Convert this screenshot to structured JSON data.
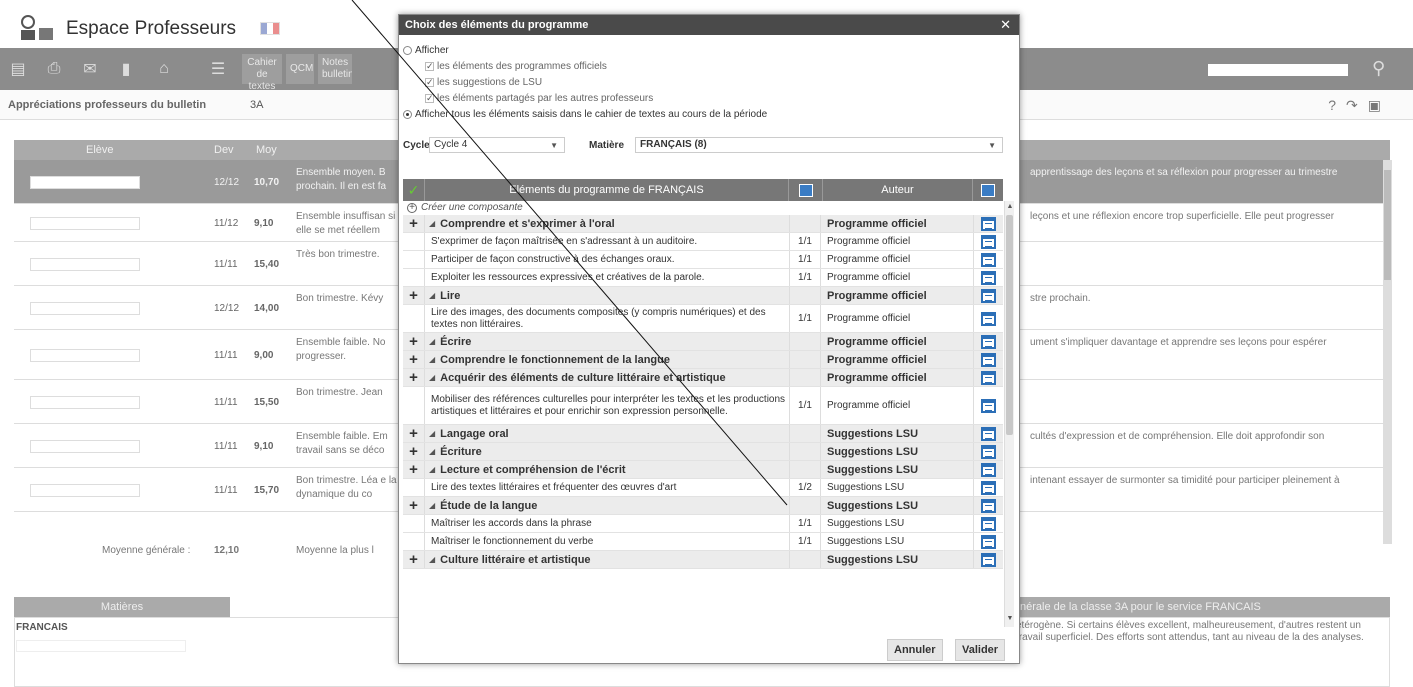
{
  "app": {
    "title": "Espace Professeurs",
    "toolbar": {
      "cahier_label": "Cahier\nde textes",
      "qcm_label": "QCM",
      "notes_label": "Notes\nbulletin"
    }
  },
  "subbar": {
    "label": "Appréciations professeurs du bulletin",
    "class": "3A"
  },
  "grid": {
    "headers": {
      "eleve": "Elève",
      "dev": "Dev",
      "moy": "Moy"
    },
    "rows": [
      {
        "dev": "12/12",
        "moy": "10,70",
        "text": "Ensemble moyen. B prochain. Il en est fa",
        "right": "apprentissage des leçons et sa réflexion pour progresser au trimestre"
      },
      {
        "dev": "11/12",
        "moy": "9,10",
        "text": "Ensemble insuffisan si elle se met réellem",
        "right": "leçons et une réflexion encore trop superficielle. Elle peut progresser"
      },
      {
        "dev": "11/11",
        "moy": "15,40",
        "text": "Très bon trimestre. ",
        "right": ""
      },
      {
        "dev": "12/12",
        "moy": "14,00",
        "text": "Bon trimestre. Kévy",
        "right": "stre prochain."
      },
      {
        "dev": "11/11",
        "moy": "9,00",
        "text": "Ensemble faible. No progresser.",
        "right": "ument s'impliquer davantage et apprendre ses leçons pour espérer"
      },
      {
        "dev": "11/11",
        "moy": "15,50",
        "text": "Bon trimestre. Jean",
        "right": ""
      },
      {
        "dev": "11/11",
        "moy": "9,10",
        "text": "Ensemble faible. Em travail sans se déco",
        "right": "cultés d'expression et de compréhension. Elle doit approfondir son"
      },
      {
        "dev": "11/11",
        "moy": "15,70",
        "text": "Bon trimestre. Léa e la dynamique du co",
        "right": "intenant essayer de surmonter sa timidité pour participer pleinement à"
      }
    ],
    "footer": {
      "label": "Moyenne générale :",
      "value": "12,10",
      "text": "Moyenne la plus l"
    }
  },
  "matieres": {
    "header": "Matières",
    "name": "FRANCAIS",
    "right_header": "nérale de la classe 3A pour le service FRANCAIS",
    "right_text": "étérogène. Si certains élèves excellent, malheureusement, d'autres restent un travail superficiel. Des efforts sont attendus, tant au niveau de la des analyses."
  },
  "dialog": {
    "title": "Choix des éléments du programme",
    "close": "✕",
    "option_afficher": "Afficher",
    "sub_options": [
      "les éléments des programmes officiels",
      "les suggestions de LSU",
      "les éléments partagés par les autres professeurs"
    ],
    "option_all": "Afficher tous les éléments saisis dans le cahier de textes au cours de la période",
    "cycle_label": "Cycle",
    "cycle_value": "Cycle 4",
    "matiere_label": "Matière",
    "matiere_value": "FRANÇAIS (8)",
    "table_header": "Eléments du programme de FRANÇAIS",
    "author_header": "Auteur",
    "create_label": "Créer une composante",
    "rows": [
      {
        "type": "cat",
        "label": "Comprendre et s'exprimer à l'oral",
        "frac": "",
        "author": "Programme officiel"
      },
      {
        "type": "item",
        "label": "S'exprimer de façon maîtrisée en s'adressant à un auditoire.",
        "frac": "1/1",
        "author": "Programme officiel"
      },
      {
        "type": "item",
        "label": "Participer de façon constructive à des échanges oraux.",
        "frac": "1/1",
        "author": "Programme officiel"
      },
      {
        "type": "item",
        "label": "Exploiter les ressources expressives et créatives de la parole.",
        "frac": "1/1",
        "author": "Programme officiel"
      },
      {
        "type": "cat",
        "label": "Lire",
        "frac": "",
        "author": "Programme officiel"
      },
      {
        "type": "item2",
        "label": "Lire des images, des documents composites (y compris numériques) et des textes non littéraires.",
        "frac": "1/1",
        "author": "Programme officiel"
      },
      {
        "type": "cat",
        "label": "Écrire",
        "frac": "",
        "author": "Programme officiel"
      },
      {
        "type": "cat",
        "label": "Comprendre le fonctionnement de la langue",
        "frac": "",
        "author": "Programme officiel"
      },
      {
        "type": "cat",
        "label": "Acquérir des éléments de culture littéraire et artistique",
        "frac": "",
        "author": "Programme officiel"
      },
      {
        "type": "item3",
        "label": "Mobiliser des références culturelles pour interpréter les textes et les productions artistiques et littéraires et pour enrichir son expression personnelle.",
        "frac": "1/1",
        "author": "Programme officiel"
      },
      {
        "type": "cat",
        "label": "Langage oral",
        "frac": "",
        "author": "Suggestions LSU"
      },
      {
        "type": "cat",
        "label": "Écriture",
        "frac": "",
        "author": "Suggestions LSU"
      },
      {
        "type": "cat",
        "label": "Lecture et compréhension de l'écrit",
        "frac": "",
        "author": "Suggestions LSU"
      },
      {
        "type": "item",
        "label": "Lire des textes littéraires et fréquenter des œuvres d'art",
        "frac": "1/2",
        "author": "Suggestions LSU"
      },
      {
        "type": "cat",
        "label": "Étude de la langue",
        "frac": "",
        "author": "Suggestions LSU"
      },
      {
        "type": "item",
        "label": "Maîtriser les accords dans la phrase",
        "frac": "1/1",
        "author": "Suggestions LSU"
      },
      {
        "type": "item",
        "label": "Maîtriser le fonctionnement du verbe",
        "frac": "1/1",
        "author": "Suggestions LSU"
      },
      {
        "type": "cat",
        "label": "Culture littéraire et artistique",
        "frac": "",
        "author": "Suggestions LSU"
      }
    ],
    "cancel_label": "Annuler",
    "validate_label": "Valider"
  },
  "colors": {
    "toolbar": "#8c8c8c",
    "dialog_title": "#4a4a4a",
    "table_header": "#777777",
    "calendar_icon": "#2c6fb7",
    "check": "#66cc33"
  }
}
